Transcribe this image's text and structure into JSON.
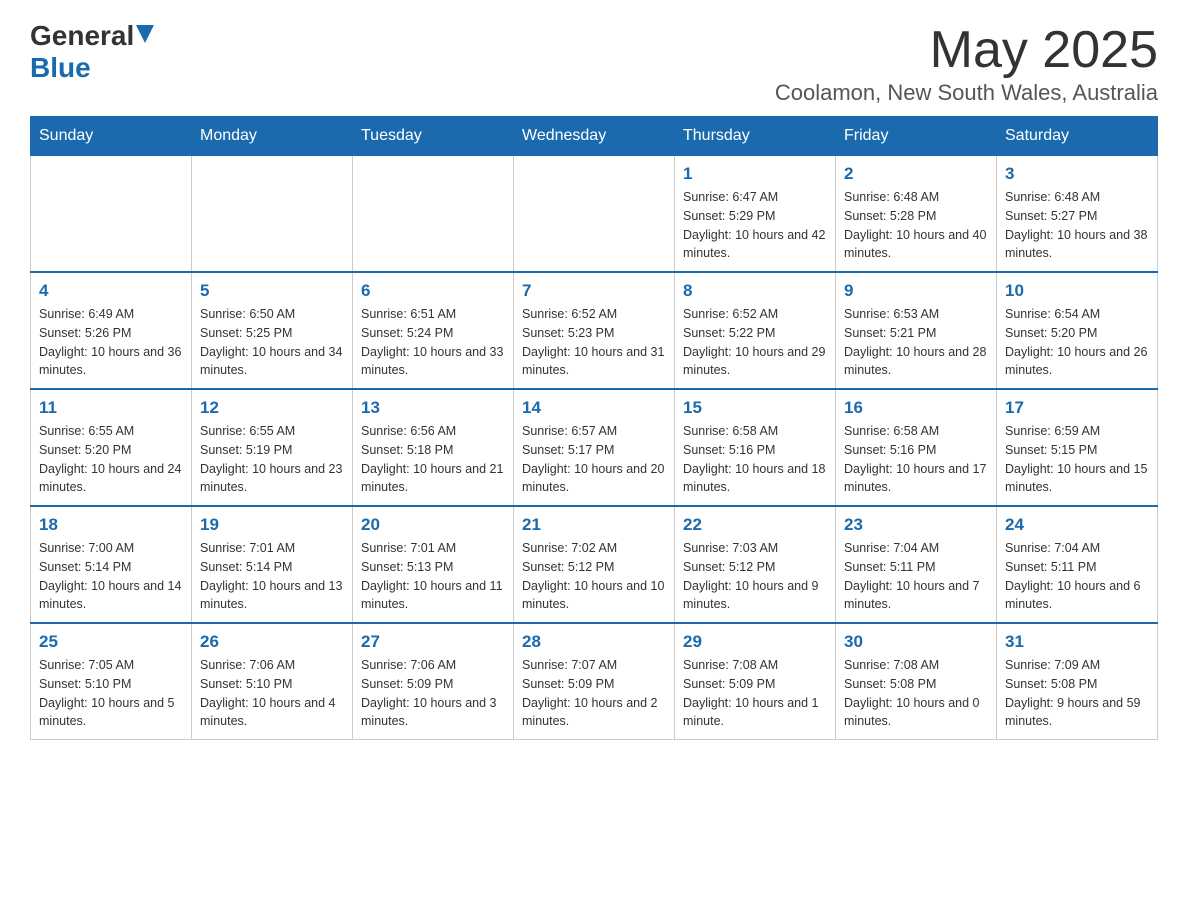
{
  "header": {
    "logo_general": "General",
    "logo_blue": "Blue",
    "month_year": "May 2025",
    "location": "Coolamon, New South Wales, Australia"
  },
  "days_of_week": [
    "Sunday",
    "Monday",
    "Tuesday",
    "Wednesday",
    "Thursday",
    "Friday",
    "Saturday"
  ],
  "weeks": [
    [
      {
        "day": "",
        "info": ""
      },
      {
        "day": "",
        "info": ""
      },
      {
        "day": "",
        "info": ""
      },
      {
        "day": "",
        "info": ""
      },
      {
        "day": "1",
        "info": "Sunrise: 6:47 AM\nSunset: 5:29 PM\nDaylight: 10 hours and 42 minutes."
      },
      {
        "day": "2",
        "info": "Sunrise: 6:48 AM\nSunset: 5:28 PM\nDaylight: 10 hours and 40 minutes."
      },
      {
        "day": "3",
        "info": "Sunrise: 6:48 AM\nSunset: 5:27 PM\nDaylight: 10 hours and 38 minutes."
      }
    ],
    [
      {
        "day": "4",
        "info": "Sunrise: 6:49 AM\nSunset: 5:26 PM\nDaylight: 10 hours and 36 minutes."
      },
      {
        "day": "5",
        "info": "Sunrise: 6:50 AM\nSunset: 5:25 PM\nDaylight: 10 hours and 34 minutes."
      },
      {
        "day": "6",
        "info": "Sunrise: 6:51 AM\nSunset: 5:24 PM\nDaylight: 10 hours and 33 minutes."
      },
      {
        "day": "7",
        "info": "Sunrise: 6:52 AM\nSunset: 5:23 PM\nDaylight: 10 hours and 31 minutes."
      },
      {
        "day": "8",
        "info": "Sunrise: 6:52 AM\nSunset: 5:22 PM\nDaylight: 10 hours and 29 minutes."
      },
      {
        "day": "9",
        "info": "Sunrise: 6:53 AM\nSunset: 5:21 PM\nDaylight: 10 hours and 28 minutes."
      },
      {
        "day": "10",
        "info": "Sunrise: 6:54 AM\nSunset: 5:20 PM\nDaylight: 10 hours and 26 minutes."
      }
    ],
    [
      {
        "day": "11",
        "info": "Sunrise: 6:55 AM\nSunset: 5:20 PM\nDaylight: 10 hours and 24 minutes."
      },
      {
        "day": "12",
        "info": "Sunrise: 6:55 AM\nSunset: 5:19 PM\nDaylight: 10 hours and 23 minutes."
      },
      {
        "day": "13",
        "info": "Sunrise: 6:56 AM\nSunset: 5:18 PM\nDaylight: 10 hours and 21 minutes."
      },
      {
        "day": "14",
        "info": "Sunrise: 6:57 AM\nSunset: 5:17 PM\nDaylight: 10 hours and 20 minutes."
      },
      {
        "day": "15",
        "info": "Sunrise: 6:58 AM\nSunset: 5:16 PM\nDaylight: 10 hours and 18 minutes."
      },
      {
        "day": "16",
        "info": "Sunrise: 6:58 AM\nSunset: 5:16 PM\nDaylight: 10 hours and 17 minutes."
      },
      {
        "day": "17",
        "info": "Sunrise: 6:59 AM\nSunset: 5:15 PM\nDaylight: 10 hours and 15 minutes."
      }
    ],
    [
      {
        "day": "18",
        "info": "Sunrise: 7:00 AM\nSunset: 5:14 PM\nDaylight: 10 hours and 14 minutes."
      },
      {
        "day": "19",
        "info": "Sunrise: 7:01 AM\nSunset: 5:14 PM\nDaylight: 10 hours and 13 minutes."
      },
      {
        "day": "20",
        "info": "Sunrise: 7:01 AM\nSunset: 5:13 PM\nDaylight: 10 hours and 11 minutes."
      },
      {
        "day": "21",
        "info": "Sunrise: 7:02 AM\nSunset: 5:12 PM\nDaylight: 10 hours and 10 minutes."
      },
      {
        "day": "22",
        "info": "Sunrise: 7:03 AM\nSunset: 5:12 PM\nDaylight: 10 hours and 9 minutes."
      },
      {
        "day": "23",
        "info": "Sunrise: 7:04 AM\nSunset: 5:11 PM\nDaylight: 10 hours and 7 minutes."
      },
      {
        "day": "24",
        "info": "Sunrise: 7:04 AM\nSunset: 5:11 PM\nDaylight: 10 hours and 6 minutes."
      }
    ],
    [
      {
        "day": "25",
        "info": "Sunrise: 7:05 AM\nSunset: 5:10 PM\nDaylight: 10 hours and 5 minutes."
      },
      {
        "day": "26",
        "info": "Sunrise: 7:06 AM\nSunset: 5:10 PM\nDaylight: 10 hours and 4 minutes."
      },
      {
        "day": "27",
        "info": "Sunrise: 7:06 AM\nSunset: 5:09 PM\nDaylight: 10 hours and 3 minutes."
      },
      {
        "day": "28",
        "info": "Sunrise: 7:07 AM\nSunset: 5:09 PM\nDaylight: 10 hours and 2 minutes."
      },
      {
        "day": "29",
        "info": "Sunrise: 7:08 AM\nSunset: 5:09 PM\nDaylight: 10 hours and 1 minute."
      },
      {
        "day": "30",
        "info": "Sunrise: 7:08 AM\nSunset: 5:08 PM\nDaylight: 10 hours and 0 minutes."
      },
      {
        "day": "31",
        "info": "Sunrise: 7:09 AM\nSunset: 5:08 PM\nDaylight: 9 hours and 59 minutes."
      }
    ]
  ]
}
